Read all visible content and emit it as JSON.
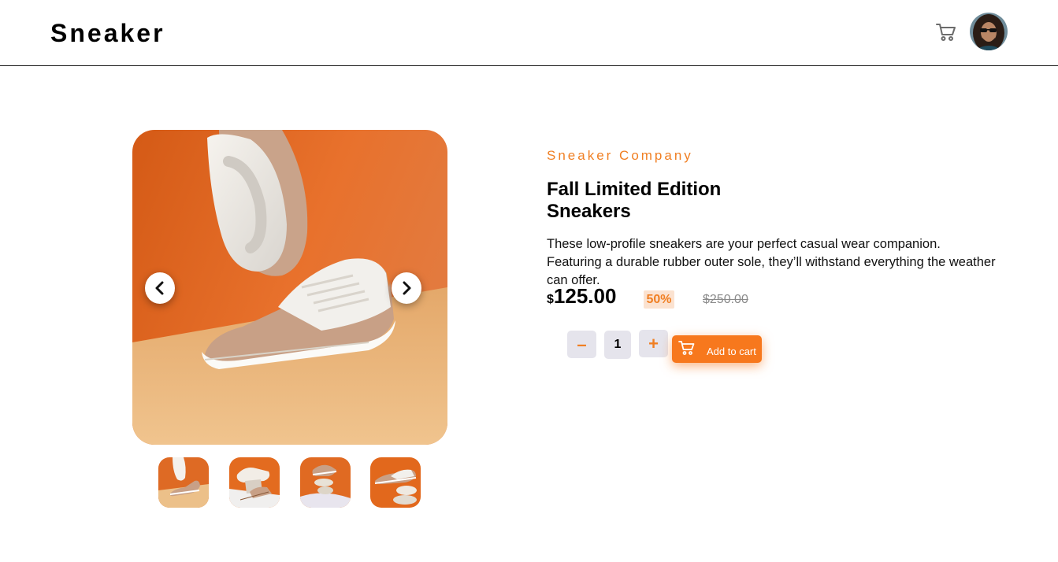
{
  "header": {
    "logo": "Sneaker",
    "cart_icon": "cart-icon",
    "avatar": "user-avatar"
  },
  "gallery": {
    "prev_icon": "chevron-left-icon",
    "next_icon": "chevron-right-icon",
    "thumbnails": [
      "thumbnail-1",
      "thumbnail-2",
      "thumbnail-3",
      "thumbnail-4"
    ]
  },
  "product": {
    "company": "Sneaker Company",
    "title_line1": "Fall Limited Edition",
    "title_line2": "Sneakers",
    "description": "These low-profile sneakers are your perfect casual wear companion. Featuring a durable rubber outer sole, they’ll withstand everything the weather can offer.",
    "currency": "$",
    "price": "125.00",
    "discount": "50%",
    "old_price": "$250.00"
  },
  "cart_controls": {
    "minus": "–",
    "quantity": "1",
    "plus": "+",
    "add_label": "Add to cart"
  },
  "colors": {
    "accent": "#f7781d",
    "accent_text": "#f07f23",
    "discount_bg": "#fbe2d0",
    "control_bg": "#e5e4ec"
  }
}
